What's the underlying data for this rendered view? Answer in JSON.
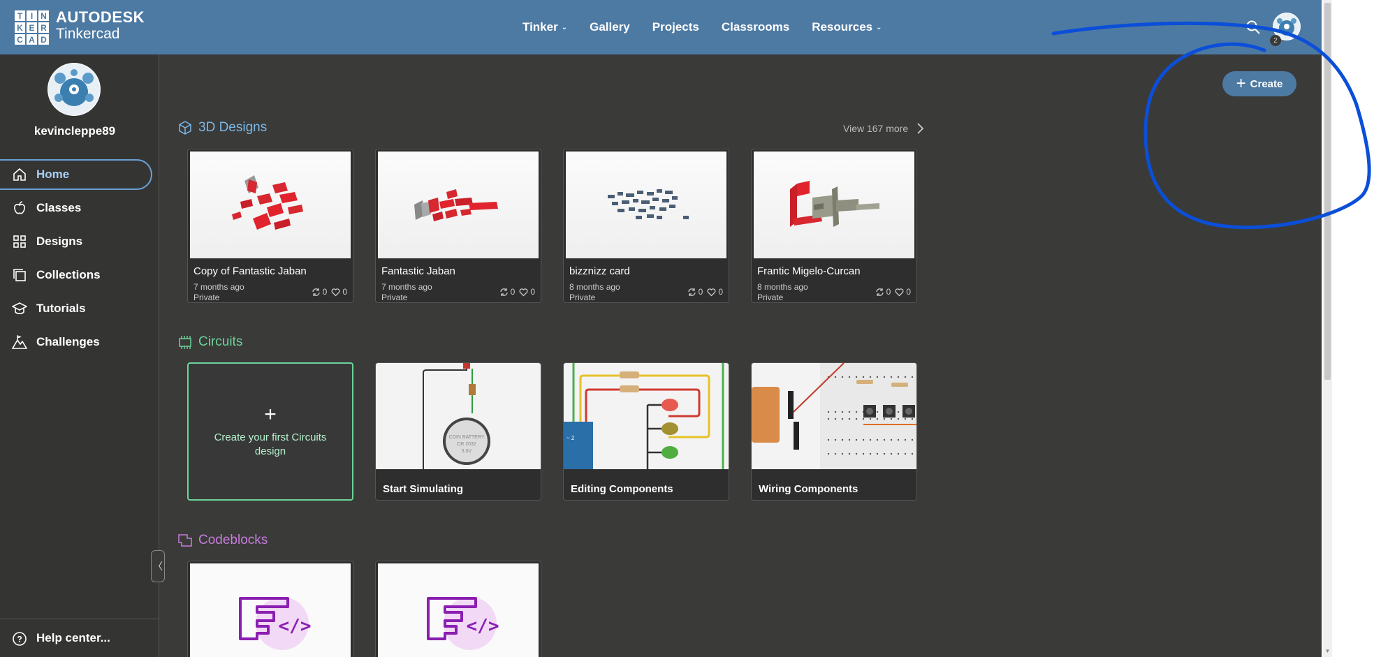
{
  "brand": {
    "logo_letters": [
      "T",
      "I",
      "N",
      "K",
      "E",
      "R",
      "C",
      "A",
      "D"
    ],
    "company": "AUTODESK",
    "product": "Tinkercad"
  },
  "nav": {
    "items": [
      {
        "label": "Tinker",
        "dropdown": true
      },
      {
        "label": "Gallery",
        "dropdown": false
      },
      {
        "label": "Projects",
        "dropdown": false
      },
      {
        "label": "Classrooms",
        "dropdown": false
      },
      {
        "label": "Resources",
        "dropdown": true
      }
    ]
  },
  "user": {
    "username": "kevincleppe89",
    "badge": "2"
  },
  "sidebar": {
    "items": [
      {
        "label": "Home",
        "icon": "home-icon",
        "active": true
      },
      {
        "label": "Classes",
        "icon": "apple-icon",
        "active": false
      },
      {
        "label": "Designs",
        "icon": "grid-icon",
        "active": false
      },
      {
        "label": "Collections",
        "icon": "collections-icon",
        "active": false
      },
      {
        "label": "Tutorials",
        "icon": "graduation-cap-icon",
        "active": false
      },
      {
        "label": "Challenges",
        "icon": "mountain-icon",
        "active": false
      }
    ],
    "help": "Help center...",
    "collapse_glyph": "〈"
  },
  "create_button": {
    "label": "Create",
    "glyph": "+"
  },
  "designs": {
    "title": "3D Designs",
    "view_more": "View 167 more",
    "cards": [
      {
        "title": "Copy of Fantastic Jaban",
        "time": "7 months ago",
        "visibility": "Private",
        "remixes": "0",
        "likes": "0"
      },
      {
        "title": "Fantastic Jaban",
        "time": "7 months ago",
        "visibility": "Private",
        "remixes": "0",
        "likes": "0"
      },
      {
        "title": "bizznizz card",
        "time": "8 months ago",
        "visibility": "Private",
        "remixes": "0",
        "likes": "0"
      },
      {
        "title": "Frantic Migelo-Curcan",
        "time": "8 months ago",
        "visibility": "Private",
        "remixes": "0",
        "likes": "0"
      }
    ]
  },
  "circuits": {
    "title": "Circuits",
    "create_first": {
      "glyph": "+",
      "label": "Create your first Circuits design"
    },
    "cards": [
      {
        "label": "Start Simulating"
      },
      {
        "label": "Editing Components"
      },
      {
        "label": "Wiring Components"
      }
    ],
    "battery_text": [
      "COIN BATTERY",
      "CR 2032",
      "3.0V"
    ]
  },
  "codeblocks": {
    "title": "Codeblocks",
    "code_glyph": "</>"
  },
  "colors": {
    "topbar": "#4d7aa3",
    "background": "#3a3a39",
    "sidebar": "#343433",
    "designs_accent": "#7ab8e8",
    "circuits_accent": "#6dd39a",
    "codeblocks_accent": "#c77ddb",
    "annotation": "#0b4fd8"
  }
}
